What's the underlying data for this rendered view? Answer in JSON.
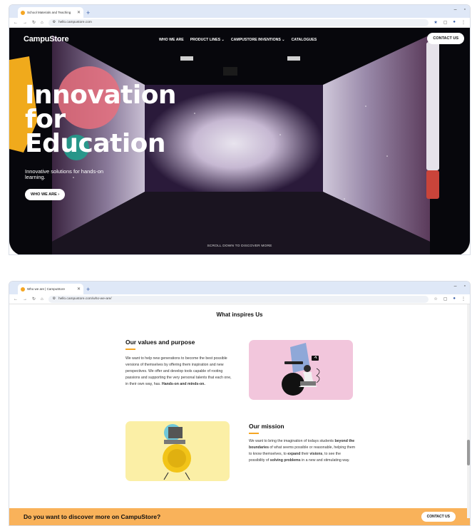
{
  "window1": {
    "tab_title": "School Materials and Teaching",
    "url": "hello.campustore.com"
  },
  "window2": {
    "tab_title": "Who we are | CampuStore",
    "url": "hello.campustore.com/who-we-are/"
  },
  "site": {
    "logo": "CampuStore",
    "nav": [
      "WHO WE ARE",
      "PRODUCT LINES",
      "CAMPUSTORE INVENTIONS",
      "CATALOGUES"
    ],
    "contact_label": "CONTACT US"
  },
  "hero": {
    "headline_line1": "Innovation",
    "headline_line2": "for",
    "headline_line3": "Education",
    "subtitle": "Innovative solutions for hands-on learning.",
    "cta": "WHO WE ARE",
    "scroll_hint": "SCROLL DOWN TO DISCOVER MORE"
  },
  "about": {
    "section_title": "What inspires Us",
    "values_title": "Our values and purpose",
    "values_text": "We want to help new generations to become the best possible versions of themselves by offering them inspiration and new perspectives. We offer and develop tools capable of rooting passions and supporting the very personal talents that each one, in their own way, has.",
    "values_bold": "Hands-on and minds-on.",
    "mission_title": "Our mission",
    "mission_text_1": "We want to bring the imagination of todays students",
    "mission_bold_1": "beyond the boundaries",
    "mission_text_2": "of what seems possible or reasonable, helping them to know themselves, to",
    "mission_bold_2": "expand",
    "mission_text_3": "their",
    "mission_bold_3": "visions",
    "mission_text_4": ", to see the possibility of",
    "mission_bold_4": "solving problems",
    "mission_text_5": "in a new and stimulating way."
  },
  "banner": {
    "question": "Do you want to discover more on CampuStore?",
    "contact_label": "CONTACT US"
  },
  "colors": {
    "accent_orange": "#f5a623",
    "banner_orange": "#f9b25a",
    "pink_card": "#f2c6dc",
    "yellow_card": "#fbefa6",
    "hero_pink": "#e8707e",
    "hero_teal": "#1fa38f"
  }
}
